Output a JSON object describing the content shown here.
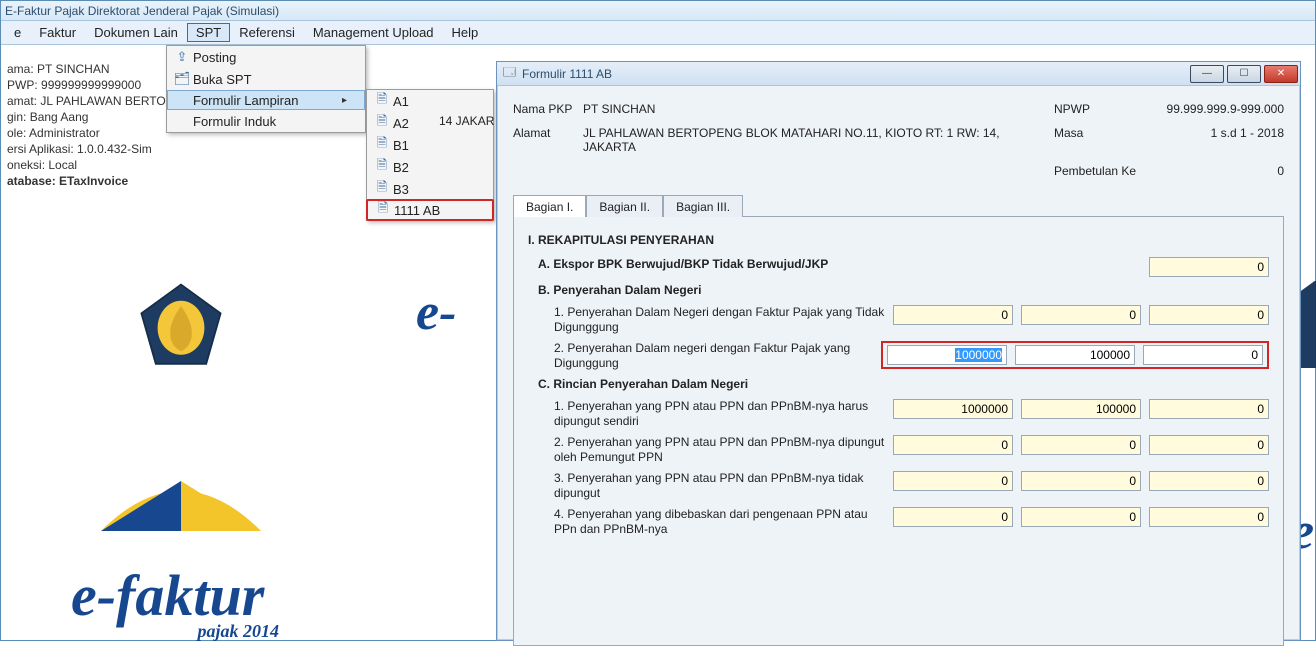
{
  "title": "E-Faktur Pajak Direktorat Jenderal Pajak (Simulasi)",
  "menu": {
    "file": "e",
    "faktur": "Faktur",
    "dokumen": "Dokumen Lain",
    "spt": "SPT",
    "referensi": "Referensi",
    "mgmt": "Management Upload",
    "help": "Help"
  },
  "spt_menu": {
    "posting": "Posting",
    "buka": "Buka SPT",
    "lampiran": "Formulir Lampiran",
    "induk": "Formulir Induk"
  },
  "lampiran_sub": {
    "a1": "A1",
    "a2": "A2",
    "b1": "B1",
    "b2": "B2",
    "b3": "B3",
    "ab": "1111 AB"
  },
  "info": {
    "nama_lbl": "ama:",
    "nama": "PT SINCHAN",
    "npwp_lbl": "PWP:",
    "npwp": "999999999999000",
    "alamat_lbl": "amat:",
    "alamat": "JL PAHLAWAN BERTO",
    "alamat_tail": "14 JAKAR",
    "login_lbl": "gin:",
    "login": "Bang Aang",
    "role_lbl": "ole:",
    "role": "Administrator",
    "versi_lbl": "ersi Aplikasi:",
    "versi": "1.0.0.432-Sim",
    "koneksi_lbl": "oneksi:",
    "koneksi": "Local",
    "db_lbl": "atabase:",
    "db": "ETaxInvoice"
  },
  "logo": {
    "brand": "e-faktur",
    "brand_partial": "e-",
    "sub": "pajak 2014"
  },
  "sub": {
    "title": "Formulir 1111 AB",
    "nama_lbl": "Nama PKP",
    "nama": "PT SINCHAN",
    "alamat_lbl": "Alamat",
    "alamat": "JL PAHLAWAN BERTOPENG BLOK MATAHARI NO.11, KIOTO RT: 1 RW: 14, JAKARTA",
    "npwp_lbl": "NPWP",
    "npwp": "99.999.999.9-999.000",
    "masa_lbl": "Masa",
    "masa": "1 s.d 1 - 2018",
    "pembetulan_lbl": "Pembetulan Ke",
    "pembetulan": "0",
    "tabs": {
      "b1": "Bagian I.",
      "b2": "Bagian II.",
      "b3": "Bagian III."
    },
    "sec": {
      "rekap": "I. REKAPITULASI PENYERAHAN",
      "a": "A. Ekspor BPK Berwujud/BKP Tidak Berwujud/JKP",
      "b": "B. Penyerahan Dalam Negeri",
      "b1": "1. Penyerahan Dalam Negeri dengan Faktur Pajak yang Tidak Digunggung",
      "b2": "2. Penyerahan Dalam negeri dengan Faktur Pajak yang Digunggung",
      "c": "C. Rincian Penyerahan Dalam Negeri",
      "c1": "1. Penyerahan yang PPN atau PPN dan PPnBM-nya harus dipungut sendiri",
      "c2": "2. Penyerahan yang PPN atau PPN dan PPnBM-nya dipungut oleh Pemungut PPN",
      "c3": "3. Penyerahan yang PPN atau PPN dan PPnBM-nya tidak dipungut",
      "c4": "4. Penyerahan yang dibebaskan dari pengenaan PPN atau PPn dan PPnBM-nya"
    },
    "vals": {
      "a": [
        "0"
      ],
      "b1": [
        "0",
        "0",
        "0"
      ],
      "b2": [
        "1000000",
        "100000",
        "0"
      ],
      "c1": [
        "1000000",
        "100000",
        "0"
      ],
      "c2": [
        "0",
        "0",
        "0"
      ],
      "c3": [
        "0",
        "0",
        "0"
      ],
      "c4": [
        "0",
        "0",
        "0"
      ]
    }
  }
}
